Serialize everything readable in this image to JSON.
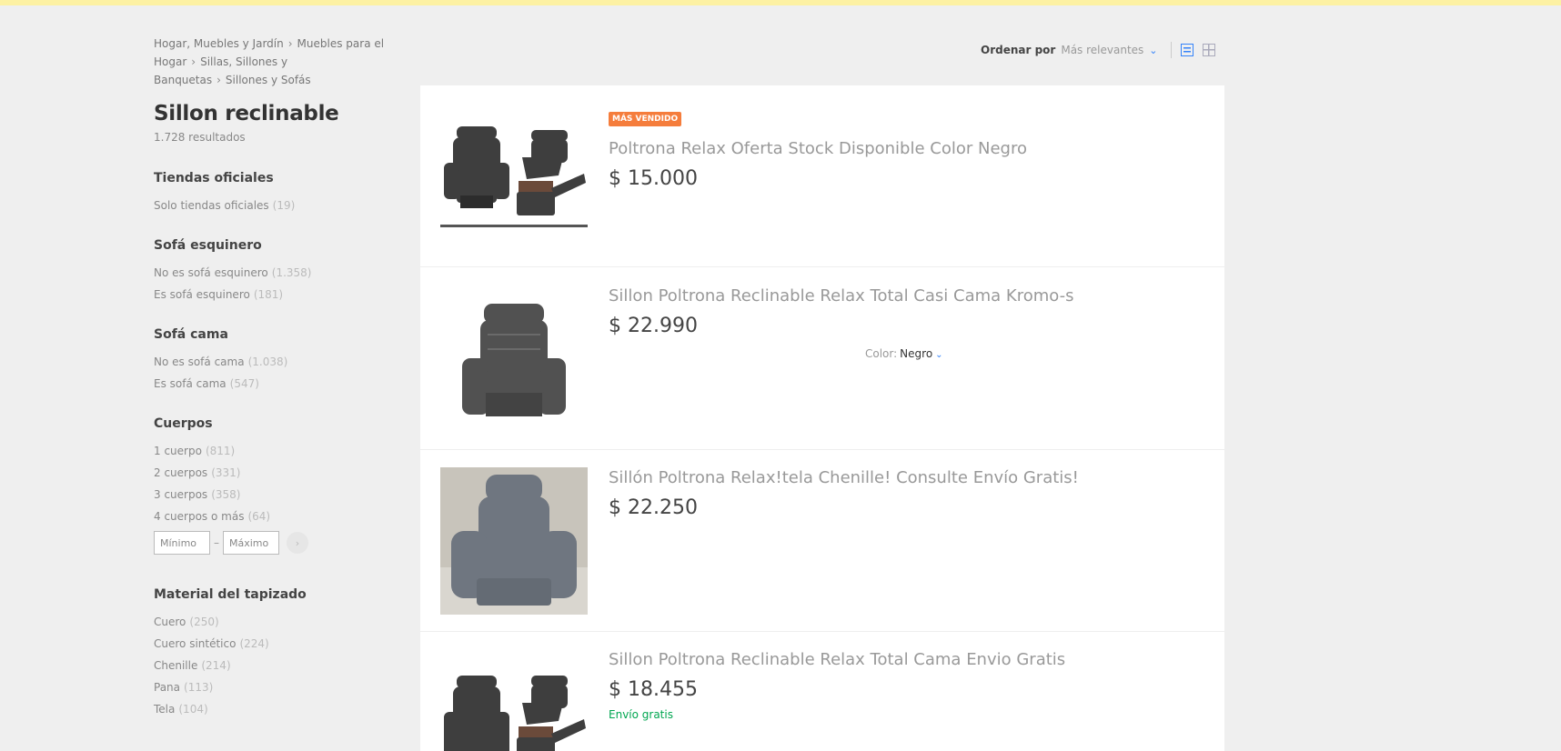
{
  "breadcrumb": [
    {
      "label": "Hogar, Muebles y Jardín"
    },
    {
      "label": "Muebles para el Hogar"
    },
    {
      "label": "Sillas, Sillones y Banquetas"
    },
    {
      "label": "Sillones y Sofás"
    }
  ],
  "page": {
    "title": "Sillon reclinable",
    "results": "1.728 resultados"
  },
  "sort": {
    "label": "Ordenar por",
    "value": "Más relevantes"
  },
  "filters": {
    "official": {
      "title": "Tiendas oficiales",
      "items": [
        {
          "label": "Solo tiendas oficiales",
          "count": "(19)"
        }
      ]
    },
    "corner": {
      "title": "Sofá esquinero",
      "items": [
        {
          "label": "No es sofá esquinero",
          "count": "(1.358)"
        },
        {
          "label": "Es sofá esquinero",
          "count": "(181)"
        }
      ]
    },
    "bed": {
      "title": "Sofá cama",
      "items": [
        {
          "label": "No es sofá cama",
          "count": "(1.038)"
        },
        {
          "label": "Es sofá cama",
          "count": "(547)"
        }
      ]
    },
    "bodies": {
      "title": "Cuerpos",
      "items": [
        {
          "label": "1 cuerpo",
          "count": "(811)"
        },
        {
          "label": "2 cuerpos",
          "count": "(331)"
        },
        {
          "label": "3 cuerpos",
          "count": "(358)"
        },
        {
          "label": "4 cuerpos o más",
          "count": "(64)"
        }
      ],
      "min_placeholder": "Mínimo",
      "max_placeholder": "Máximo",
      "range_dash": "–"
    },
    "material": {
      "title": "Material del tapizado",
      "items": [
        {
          "label": "Cuero",
          "count": "(250)"
        },
        {
          "label": "Cuero sintético",
          "count": "(224)"
        },
        {
          "label": "Chenille",
          "count": "(214)"
        },
        {
          "label": "Pana",
          "count": "(113)"
        },
        {
          "label": "Tela",
          "count": "(104)"
        }
      ]
    }
  },
  "items": [
    {
      "badge": "MÁS VENDIDO",
      "title": "Poltrona Relax Oferta Stock Disponible Color Negro",
      "price": "$ 15.000"
    },
    {
      "title": "Sillon Poltrona Reclinable Relax Total Casi Cama Kromo-s",
      "price": "$ 22.990",
      "color_label": "Color:",
      "color_value": "Negro"
    },
    {
      "title": "Sillón Poltrona Relax!tela Chenille! Consulte Envío Gratis!",
      "price": "$ 22.250"
    },
    {
      "title": "Sillon Poltrona Reclinable Relax Total Cama Envio Gratis",
      "price": "$ 18.455",
      "shipping": "Envío gratis"
    }
  ],
  "colors": {
    "accent": "#3483fa",
    "badge": "#f57d3c",
    "shipping": "#00a650",
    "topbar": "#fdf1a3"
  }
}
